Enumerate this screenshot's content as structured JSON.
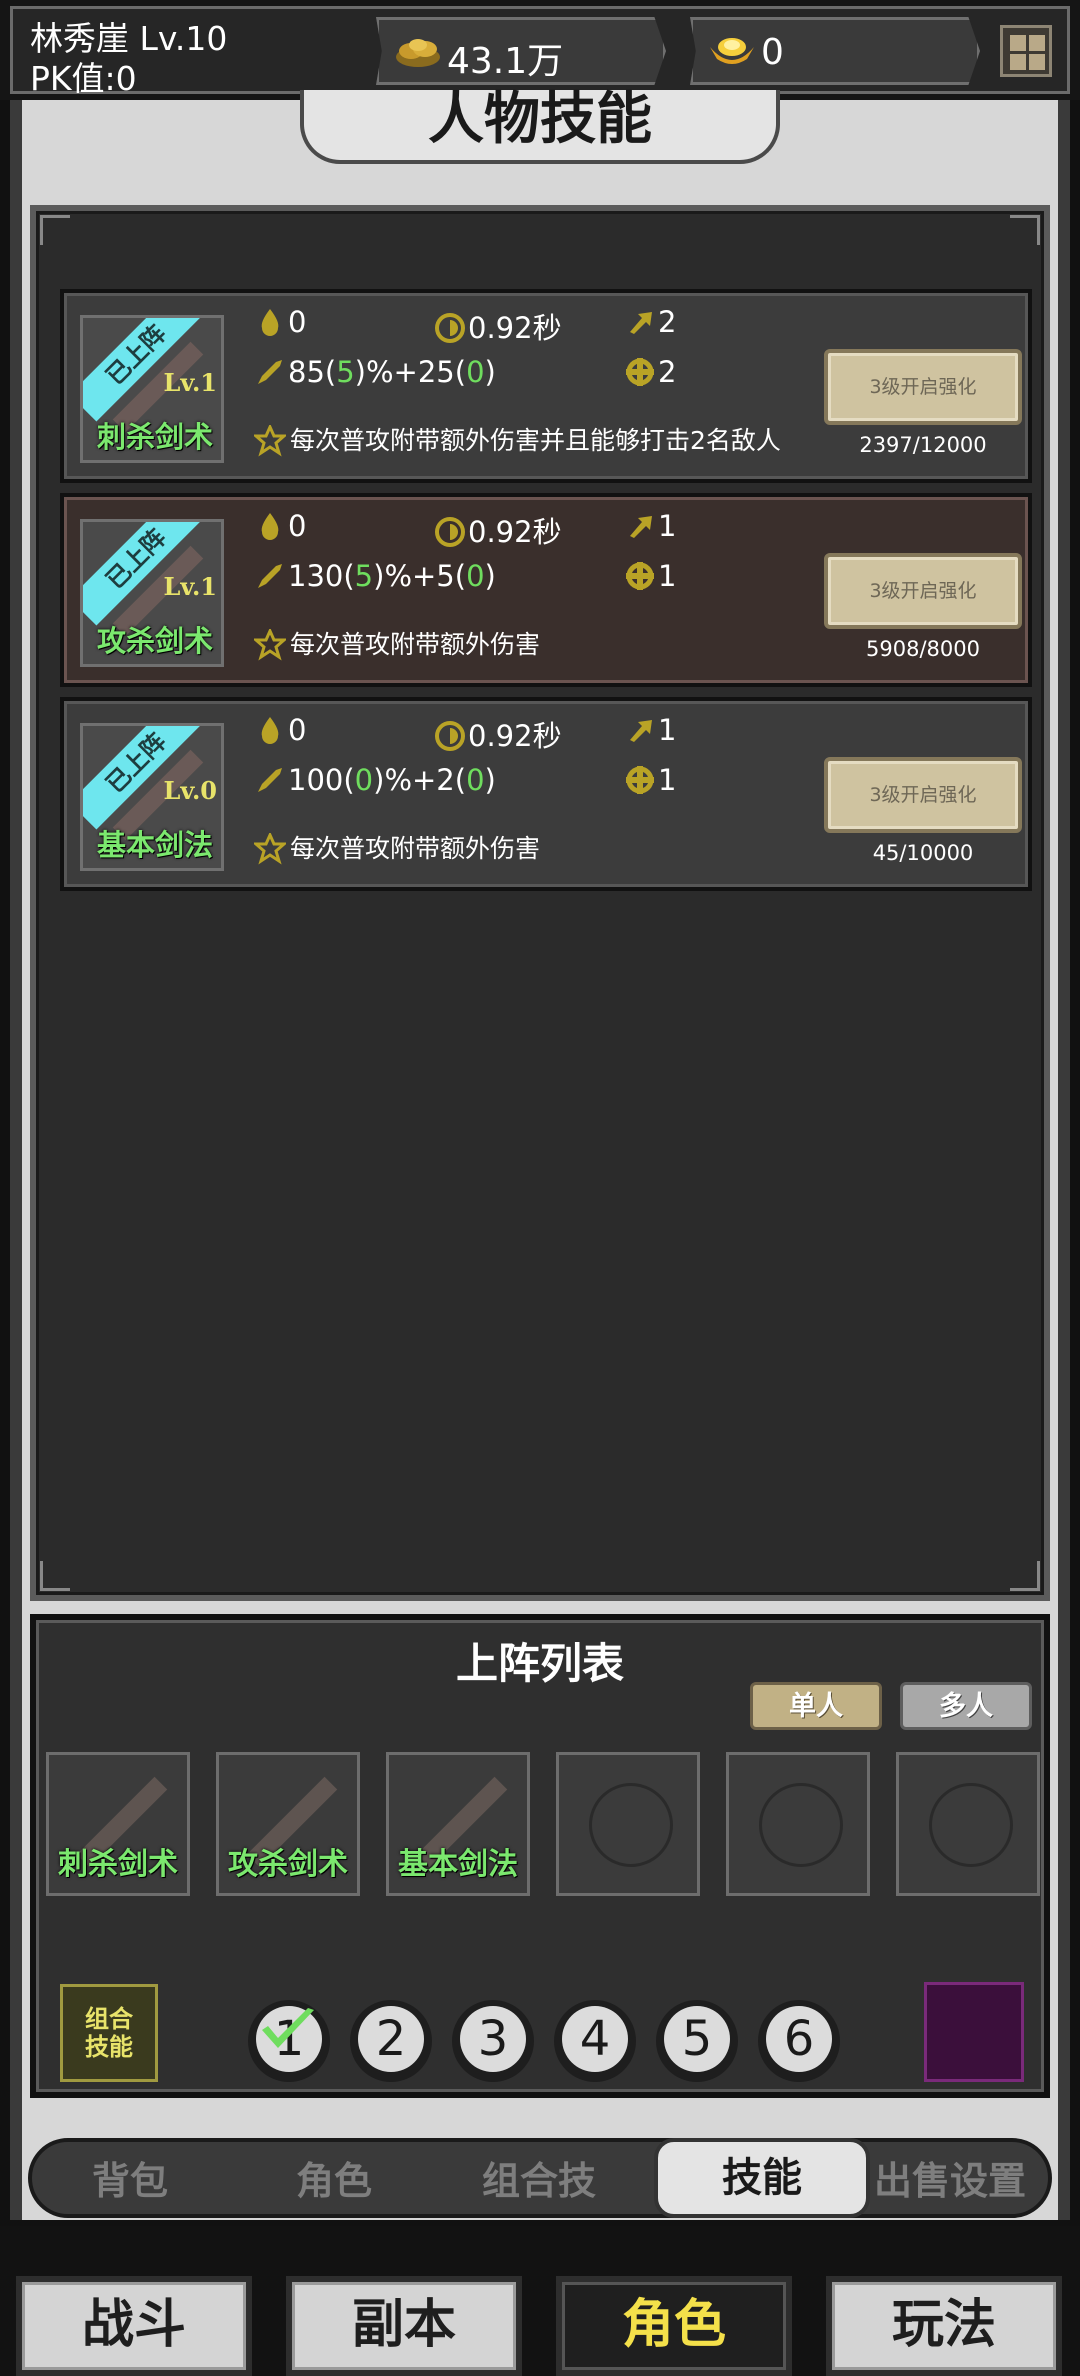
{
  "header": {
    "player_name": "林秀崖  Lv.10",
    "pk_value": "PK值:0",
    "gold": "43.1万",
    "ingot": "0"
  },
  "panel": {
    "title": "人物技能"
  },
  "skills": [
    {
      "badge": "已上阵",
      "level": "Lv.1",
      "name": "刺杀剑术",
      "mp_cost": "0",
      "cooldown": "0.92秒",
      "targets": "2",
      "damage_base": "85(",
      "damage_coef": "5",
      "damage_mid": ")%+25(",
      "damage_bonus": "0",
      "damage_end": ")",
      "range": "2",
      "description": "每次普攻附带额外伤害并且能够打击2名敌人",
      "enhance_label": "3级开启强化",
      "progress": "2397/12000"
    },
    {
      "badge": "已上阵",
      "level": "Lv.1",
      "name": "攻杀剑术",
      "mp_cost": "0",
      "cooldown": "0.92秒",
      "targets": "1",
      "damage_base": "130(",
      "damage_coef": "5",
      "damage_mid": ")%+5(",
      "damage_bonus": "0",
      "damage_end": ")",
      "range": "1",
      "description": "每次普攻附带额外伤害",
      "enhance_label": "3级开启强化",
      "progress": "5908/8000"
    },
    {
      "badge": "已上阵",
      "level": "Lv.0",
      "name": "基本剑法",
      "mp_cost": "0",
      "cooldown": "0.92秒",
      "targets": "1",
      "damage_base": "100(",
      "damage_coef": "0",
      "damage_mid": ")%+2(",
      "damage_bonus": "0",
      "damage_end": ")",
      "range": "1",
      "description": "每次普攻附带额外伤害",
      "enhance_label": "3级开启强化",
      "progress": "45/10000"
    }
  ],
  "lineup": {
    "title": "上阵列表",
    "mode_single": "单人",
    "mode_multi": "多人",
    "slots": [
      "刺杀剑术",
      "攻杀剑术",
      "基本剑法",
      "",
      "",
      ""
    ],
    "combo_label_1": "组合",
    "combo_label_2": "技能",
    "numbers": [
      "1",
      "2",
      "3",
      "4",
      "5",
      "6"
    ]
  },
  "subtabs": [
    "背包",
    "角色",
    "组合技",
    "技能",
    "出售设置"
  ],
  "active_subtab": "技能",
  "nav": [
    "战斗",
    "副本",
    "角色",
    "玩法"
  ],
  "active_nav": "角色",
  "colors": {
    "accent_green": "#6fdd5e",
    "badge_cyan": "#6ee6ee",
    "level_yellow": "#e8e36a",
    "nav_active": "#f4e04a"
  }
}
